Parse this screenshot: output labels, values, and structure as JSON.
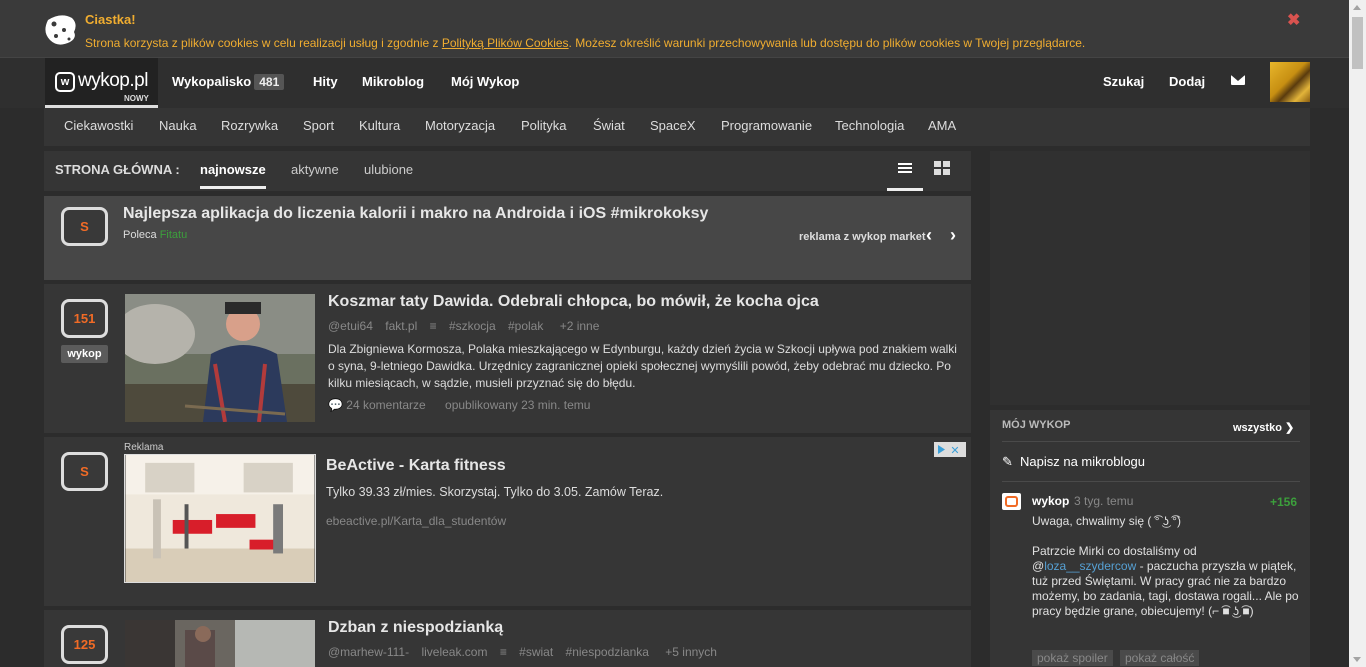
{
  "cookie_bar": {
    "title": "Ciastka!",
    "text_before": "Strona korzysta z plików cookies w celu realizacji usług i zgodnie z ",
    "link": "Polityką Plików Cookies",
    "text_after": ". Możesz określić warunki przechowywania lub dostępu do plików cookies w Twojej przeglądarce.",
    "close": "✖"
  },
  "nav": {
    "logo": "wykop.pl",
    "logo_sub": "NOWY",
    "items": [
      "Wykopalisko",
      "Hity",
      "Mikroblog",
      "Mój Wykop"
    ],
    "wykopalisko_count": "481",
    "right": [
      "Szukaj",
      "Dodaj"
    ]
  },
  "categories": [
    "Ciekawostki",
    "Nauka",
    "Rozrywka",
    "Sport",
    "Kultura",
    "Motoryzacja",
    "Polityka",
    "Świat",
    "SpaceX",
    "Programowanie",
    "Technologia",
    "AMA"
  ],
  "tabs": {
    "label": "STRONA GŁÓWNA :",
    "items": [
      "najnowsze",
      "aktywne",
      "ulubione"
    ],
    "active": "najnowsze"
  },
  "promo": {
    "vote": "S",
    "title": "Najlepsza aplikacja do liczenia kalorii i makro na Androida i iOS #mikrokoksy",
    "recommended_by_label": "Poleca",
    "recommended_by": "Fitatu",
    "ad_label": "reklama z wykop market",
    "prev": "‹",
    "next": "›"
  },
  "entries": [
    {
      "votes": "151",
      "vote_button": "wykop",
      "title": "Koszmar taty Dawida. Odebrali chłopca, bo mówił, że kocha ojca",
      "author": "@etui64",
      "domain": "fakt.pl",
      "tags": [
        "#szkocja",
        "#polak"
      ],
      "more_tags": "+2 inne",
      "description": "Dla Zbigniewa Kormosza, Polaka mieszkającego w Edynburgu, każdy dzień życia w Szkocji upływa pod znakiem walki o syna, 9-letniego Dawidka. Urzędnicy zagranicznej opieki społecznej wymyślili powód, żeby odebrać mu dziecko. Po kilku miesiącach, w sądzie, musieli przyznać się do błędu.",
      "comments": "24 komentarze",
      "published": "opublikowany 23 min. temu"
    },
    {
      "votes": "S",
      "ad_tag": "Reklama",
      "title": "BeActive - Karta fitness",
      "description": "Tylko 39.33 zł/mies. Skorzystaj. Tylko do 3.05. Zamów Teraz.",
      "url": "ebeactive.pl/Karta_dla_studentów"
    },
    {
      "votes": "125",
      "title": "Dzban z niespodzianką",
      "author": "@marhew-111-",
      "domain": "liveleak.com",
      "tags": [
        "#swiat",
        "#niespodzianka"
      ],
      "more_tags": "+5 innych"
    }
  ],
  "sidebar": {
    "label": "MÓJ WYKOP",
    "filter": "wszystko",
    "write": "Napisz na mikroblogu",
    "post": {
      "author": "wykop",
      "time": "3 tyg. temu",
      "score": "+156",
      "line1": "Uwaga, chwalimy się ( ͡° ͜ʖ ͡°)",
      "line2_before": "Patrzcie Mirki co dostaliśmy od @",
      "line2_link": "loza__szydercow",
      "line2_after": " - paczucha przyszła w piątek, tuż przed Świętami. W pracy grać nie za bardzo możemy, bo zadania, tagi, dostawa rogali... Ale po pracy będzie grane, obiecujemy! (⌐ ͡■ ͜ʖ ͡■)",
      "show_spoiler": "pokaż spoiler",
      "show_all": "pokaż całość"
    }
  },
  "colors": {
    "accent_orange": "#f16b26",
    "cookie_text": "#f0ad30",
    "link_blue": "#56a0d3",
    "score_green": "#3c9f3c"
  }
}
